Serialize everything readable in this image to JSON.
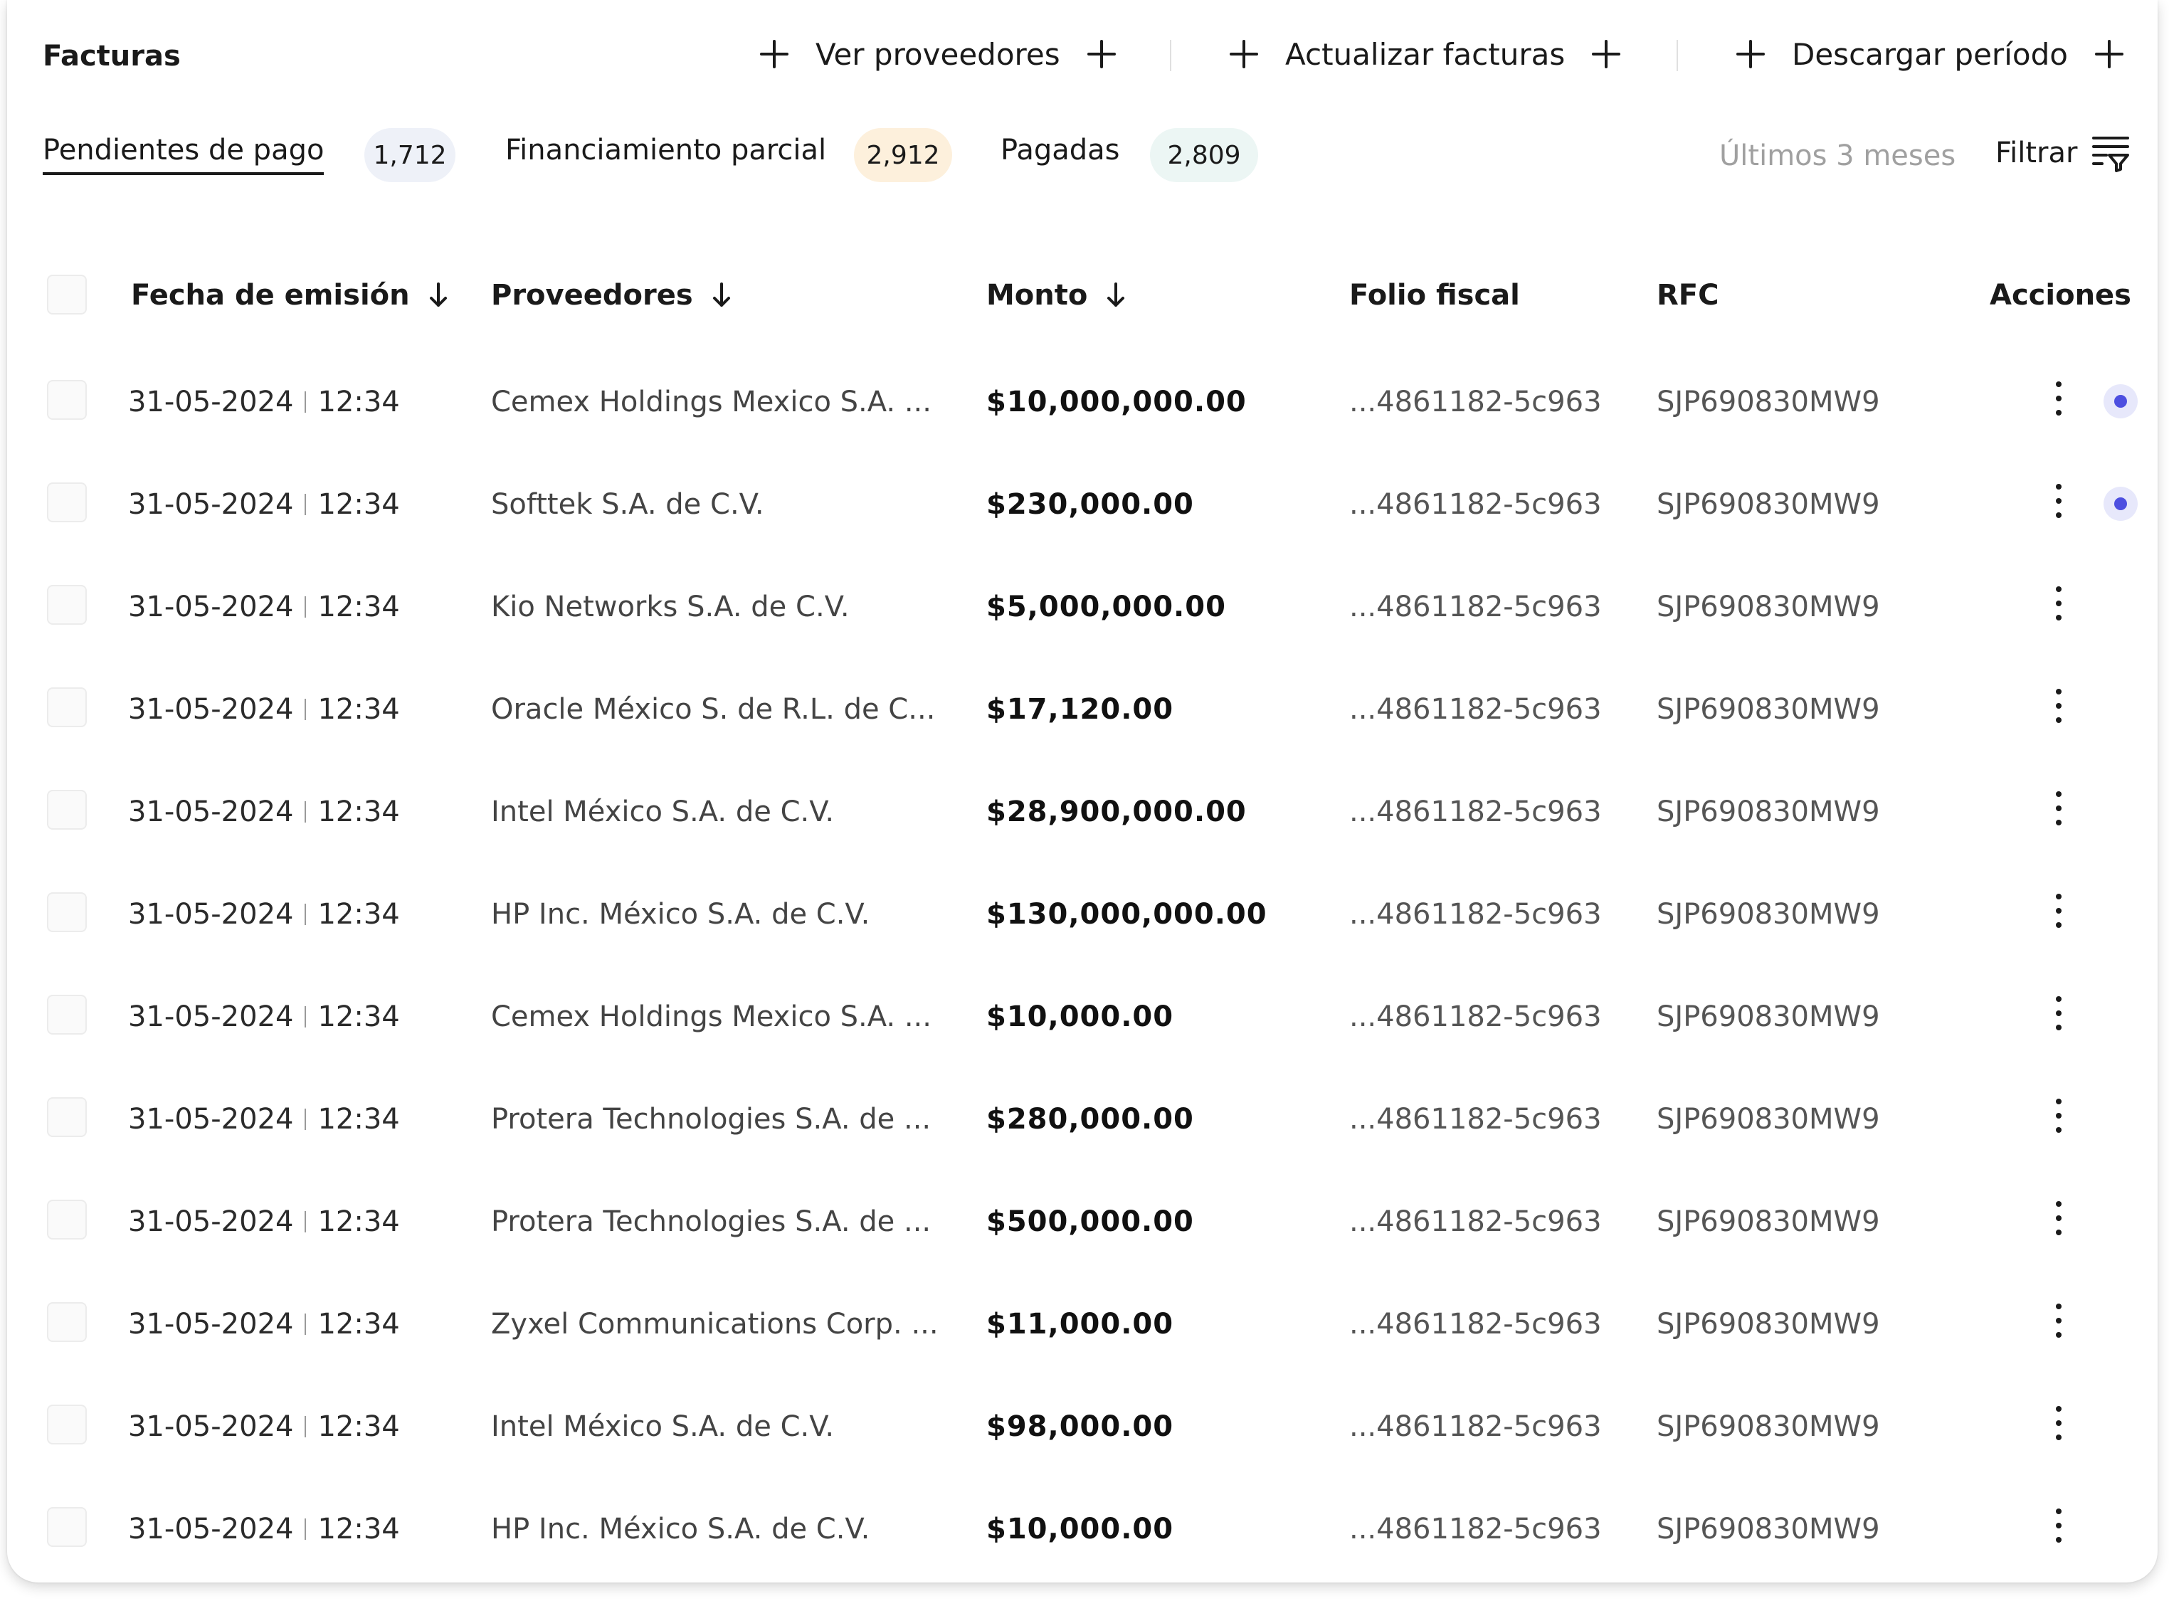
{
  "header": {
    "title": "Facturas",
    "actions": [
      "Ver proveedores",
      "Actualizar facturas",
      "Descargar período"
    ]
  },
  "tabs": [
    {
      "label": "Pendientes de pago",
      "count": "1,712",
      "badge_color": "#eef1f8",
      "active": true
    },
    {
      "label": "Financiamiento parcial",
      "count": "2,912",
      "badge_color": "#fdf0dc",
      "active": false
    },
    {
      "label": "Pagadas",
      "count": "2,809",
      "badge_color": "#ecf6f4",
      "active": false
    }
  ],
  "range_label": "Últimos 3 meses",
  "filter_label": "Filtrar",
  "columns": {
    "date": "Fecha de emisión",
    "provider": "Proveedores",
    "amount": "Monto",
    "folio": "Folio fiscal",
    "rfc": "RFC",
    "actions": "Acciones"
  },
  "rows": [
    {
      "date": "31-05-2024",
      "time": "12:34",
      "provider": "Cemex Holdings Mexico S.A. ...",
      "amount": "$10,000,000.00",
      "folio": "...4861182-5c963",
      "rfc": "SJP690830MW9",
      "indicator": true
    },
    {
      "date": "31-05-2024",
      "time": "12:34",
      "provider": "Softtek S.A. de C.V.",
      "amount": "$230,000.00",
      "folio": "...4861182-5c963",
      "rfc": "SJP690830MW9",
      "indicator": true
    },
    {
      "date": "31-05-2024",
      "time": "12:34",
      "provider": "Kio Networks S.A. de C.V.",
      "amount": "$5,000,000.00",
      "folio": "...4861182-5c963",
      "rfc": "SJP690830MW9",
      "indicator": false
    },
    {
      "date": "31-05-2024",
      "time": "12:34",
      "provider": "Oracle México S. de R.L. de C...",
      "amount": "$17,120.00",
      "folio": "...4861182-5c963",
      "rfc": "SJP690830MW9",
      "indicator": false
    },
    {
      "date": "31-05-2024",
      "time": "12:34",
      "provider": "Intel México S.A. de C.V.",
      "amount": "$28,900,000.00",
      "folio": "...4861182-5c963",
      "rfc": "SJP690830MW9",
      "indicator": false
    },
    {
      "date": "31-05-2024",
      "time": "12:34",
      "provider": "HP Inc. México S.A. de C.V.",
      "amount": "$130,000,000.00",
      "folio": "...4861182-5c963",
      "rfc": "SJP690830MW9",
      "indicator": false
    },
    {
      "date": "31-05-2024",
      "time": "12:34",
      "provider": "Cemex Holdings Mexico S.A. ...",
      "amount": "$10,000.00",
      "folio": "...4861182-5c963",
      "rfc": "SJP690830MW9",
      "indicator": false
    },
    {
      "date": "31-05-2024",
      "time": "12:34",
      "provider": "Protera Technologies S.A. de ...",
      "amount": "$280,000.00",
      "folio": "...4861182-5c963",
      "rfc": "SJP690830MW9",
      "indicator": false
    },
    {
      "date": "31-05-2024",
      "time": "12:34",
      "provider": "Protera Technologies S.A. de ...",
      "amount": "$500,000.00",
      "folio": "...4861182-5c963",
      "rfc": "SJP690830MW9",
      "indicator": false
    },
    {
      "date": "31-05-2024",
      "time": "12:34",
      "provider": "Zyxel Communications Corp. ...",
      "amount": "$11,000.00",
      "folio": "...4861182-5c963",
      "rfc": "SJP690830MW9",
      "indicator": false
    },
    {
      "date": "31-05-2024",
      "time": "12:34",
      "provider": "Intel México S.A. de C.V.",
      "amount": "$98,000.00",
      "folio": "...4861182-5c963",
      "rfc": "SJP690830MW9",
      "indicator": false
    },
    {
      "date": "31-05-2024",
      "time": "12:34",
      "provider": "HP Inc. México S.A. de C.V.",
      "amount": "$10,000.00",
      "folio": "...4861182-5c963",
      "rfc": "SJP690830MW9",
      "indicator": false
    }
  ]
}
